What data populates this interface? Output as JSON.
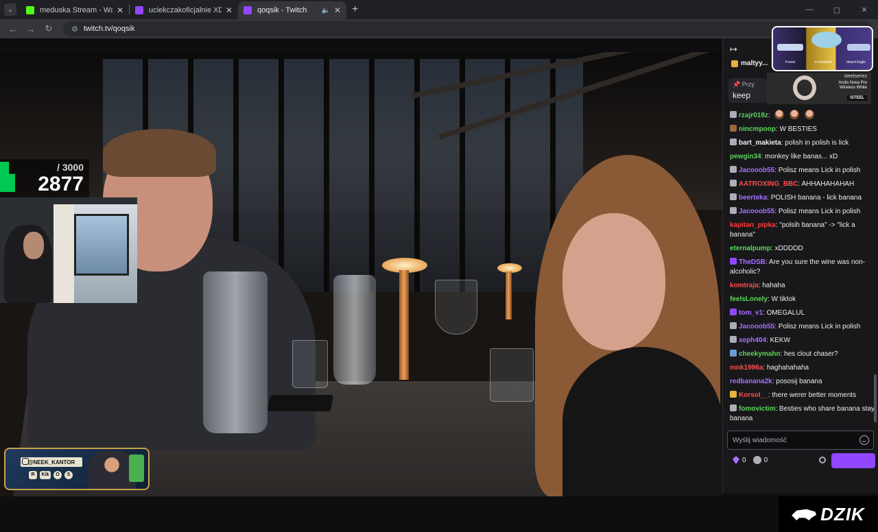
{
  "browser": {
    "tabs": [
      {
        "title": "meduska Stream - Watch Live o",
        "favicon_color": "#53fc18",
        "active": false
      },
      {
        "title": "uciekczakoficjalnie XD - Twitch",
        "favicon_color": "#9147ff",
        "active": false
      },
      {
        "title": "qoqsik - Twitch",
        "favicon_color": "#9147ff",
        "active": true
      }
    ],
    "url": "twitch.tv/qoqsik"
  },
  "stream": {
    "goal": {
      "target": "/ 3000",
      "current": "2877",
      "progress_fraction": 0.959
    },
    "promo": {
      "handle": "@NEEK_KANTOR",
      "small_icons": [
        "R",
        "Kik",
        "O",
        "S"
      ]
    }
  },
  "ads": {
    "top": {
      "captions": [
        "Forest",
        "w Karambit",
        "desert Eagle"
      ]
    },
    "steelseries": {
      "brand": "steelseries",
      "product": "Arctis Nova Pro Wireless White",
      "code": "!STEEL"
    }
  },
  "chat": {
    "pinned_user": "maltyy...",
    "pinned_label": "Przy",
    "pinned_word": "keep",
    "messages": [
      {
        "user": "rzajr018z",
        "color": "#5cd65c",
        "text": "",
        "emotes": 3,
        "badge": "#adadb8"
      },
      {
        "user": "nincmpoop",
        "color": "#5cd65c",
        "text": "W BESTIES",
        "badge": "#9a6a3a"
      },
      {
        "user": "bart_makieta",
        "color": "#efeff1",
        "text": "polish in polish is lick",
        "badge": "#adadb8"
      },
      {
        "user": "pewgin34",
        "color": "#5cd65c",
        "text": "monkey like banas... xD"
      },
      {
        "user": "Jacooob55",
        "color": "#a970ff",
        "text": "Polisz means Lick in polish",
        "badge": "#adadb8"
      },
      {
        "user": "AATROXING_BBC",
        "color": "#ff4d4d",
        "text": "AHHAHAHAHAH",
        "badge": "#adadb8"
      },
      {
        "user": "beerteka",
        "color": "#a970ff",
        "text": "POLISH banana - lick banana",
        "badge": "#adadb8"
      },
      {
        "user": "Jacooob55",
        "color": "#a970ff",
        "text": "Polisz means Lick in polish",
        "badge": "#adadb8"
      },
      {
        "user": "kapitan_pipka",
        "color": "#ff3a3a",
        "text": "\"polsih banana\" -> \"lick a banana\"",
        "wrap": true
      },
      {
        "user": "eternalpump",
        "color": "#5cd65c",
        "text": "xDDDDD"
      },
      {
        "user": "TheDSB",
        "color": "#a970ff",
        "text": "Are you sure the wine was non-alcoholic?",
        "badge": "#9147ff",
        "wrap": true
      },
      {
        "user": "komtraja",
        "color": "#ff4d4d",
        "text": "hahaha"
      },
      {
        "user": "feelsLonely",
        "color": "#5cd65c",
        "text": "W tiktok"
      },
      {
        "user": "tom_v1",
        "color": "#a970ff",
        "text": "OMEGALUL",
        "badge": "#9147ff"
      },
      {
        "user": "Jacooob55",
        "color": "#a970ff",
        "text": "Polisz means Lick in polish",
        "badge": "#adadb8"
      },
      {
        "user": "xeph404",
        "color": "#a970ff",
        "text": "KEKW",
        "badge": "#adadb8"
      },
      {
        "user": "cheekymahn",
        "color": "#5cd65c",
        "text": "hes clout chaser?",
        "badge": "#6a9bd6"
      },
      {
        "user": "mnk1996a",
        "color": "#ff4d4d",
        "text": "haghahahaha"
      },
      {
        "user": "redbanana2k",
        "color": "#a970ff",
        "text": "pososij banana"
      },
      {
        "user": "Korsol__",
        "color": "#ff4d4d",
        "text": "there werer better moments",
        "badge": "#e5b43c"
      },
      {
        "user": "fomovictim",
        "color": "#5cd65c",
        "text": "Besties who share banana stay banana",
        "badge": "#adadb8",
        "wrap": true
      }
    ],
    "input_placeholder": "Wyślij wiadomość",
    "points_a": "0",
    "points_b": "0"
  },
  "overlay_brand": "DZIK"
}
